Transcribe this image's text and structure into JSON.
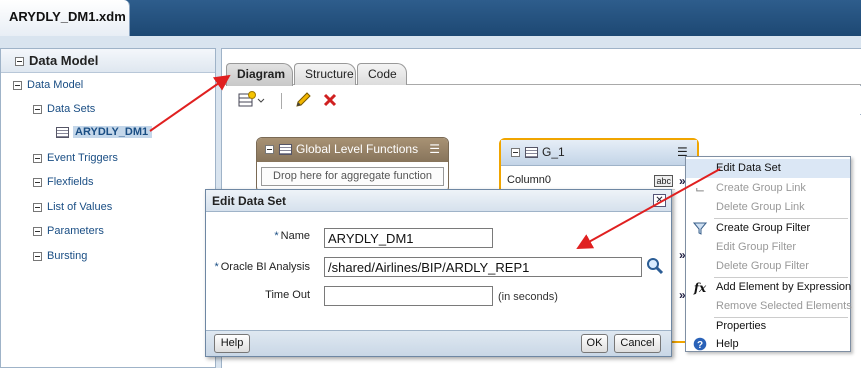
{
  "document": {
    "tab_title": "ARYDLY_DM1.xdm"
  },
  "left_panel": {
    "title": "Data Model",
    "tree": {
      "root": "Data Model",
      "data_sets": "Data Sets",
      "selected_item": "ARYDLY_DM1",
      "event_triggers": "Event Triggers",
      "flexfields": "Flexfields",
      "list_of_values": "List of Values",
      "parameters": "Parameters",
      "bursting": "Bursting"
    }
  },
  "tabs": {
    "diagram": "Diagram",
    "structure": "Structure",
    "code": "Code"
  },
  "diagram": {
    "global_functions": {
      "title": "Global Level Functions",
      "drop_hint": "Drop here for aggregate function"
    },
    "group": {
      "title": "G_1",
      "column": "Column0",
      "type_badge": "abc"
    }
  },
  "context_menu": {
    "items": [
      {
        "label": "Edit Data Set",
        "enabled": true
      },
      {
        "label": "Create Group Link",
        "enabled": false
      },
      {
        "label": "Delete Group Link",
        "enabled": false
      },
      {
        "label": "Create Group Filter",
        "enabled": true
      },
      {
        "label": "Edit Group Filter",
        "enabled": false
      },
      {
        "label": "Delete Group Filter",
        "enabled": false
      },
      {
        "label": "Add Element by Expression",
        "enabled": true
      },
      {
        "label": "Remove Selected Elements",
        "enabled": false
      },
      {
        "label": "Properties",
        "enabled": true
      },
      {
        "label": "Help",
        "enabled": true
      }
    ]
  },
  "dialog": {
    "title": "Edit Data Set",
    "name_label": "Name",
    "name_value": "ARYDLY_DM1",
    "analysis_label": "Oracle BI Analysis",
    "analysis_value": "/shared/Airlines/BIP/ARDLY_REP1",
    "timeout_label": "Time Out",
    "timeout_value": "",
    "timeout_hint": "(in seconds)",
    "required_mark": "*",
    "help_button": "Help",
    "ok_button": "OK",
    "cancel_button": "Cancel"
  },
  "colors": {
    "accent": "#1a4e84",
    "arrow": "#e02020",
    "selected_group_border": "#f0a500"
  },
  "icons": [
    "table-icon",
    "pencil-icon",
    "delete-icon",
    "new-dataset-icon",
    "search-icon",
    "filter-icon",
    "fx-icon",
    "help-icon",
    "close-icon",
    "group-link-icon",
    "menu-icon"
  ]
}
